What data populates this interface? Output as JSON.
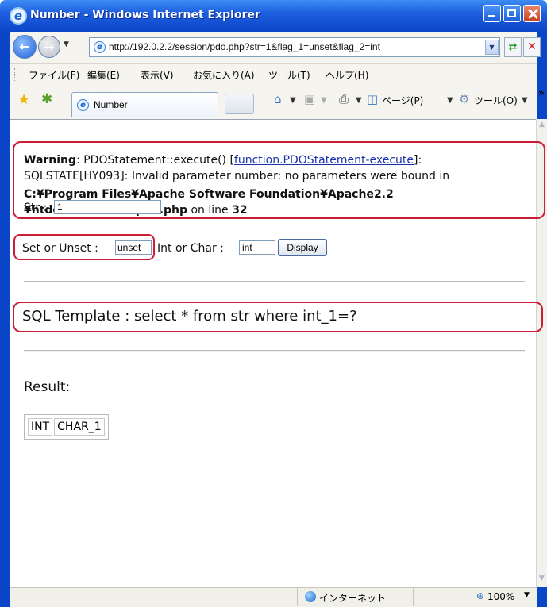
{
  "window": {
    "title": "Number - Windows Internet Explorer"
  },
  "address": {
    "url": "http://192.0.2.2/session/pdo.php?str=1&flag_1=unset&flag_2=int"
  },
  "menu": {
    "items": [
      "ファイル(F)",
      "編集(E)",
      "表示(V)",
      "お気に入り(A)",
      "ツール(T)",
      "ヘルプ(H)"
    ]
  },
  "tabs": {
    "active_label": "Number"
  },
  "command_bar": {
    "page": "ページ(P)",
    "tools": "ツール(O)"
  },
  "page": {
    "warning": {
      "label": "Warning",
      "line1_pre": ": PDOStatement::execute() [",
      "link": "function.PDOStatement-execute",
      "line1_post": "]:",
      "line2": "SQLSTATE[HY093]: Invalid parameter number: no parameters were bound in",
      "line3": "C:¥Program Files¥Apache Software Foundation¥Apache2.2",
      "line4_path": "¥htdocs¥session¥pdo.php",
      "line4_mid": " on line ",
      "line4_num": "32"
    },
    "form": {
      "str_label": "Str :",
      "str_value": "1",
      "setunset_label": "Set or Unset :",
      "setunset_value": "unset",
      "intchar_label": "Int or Char :",
      "intchar_value": "int",
      "display_button": "Display"
    },
    "sql_template": "SQL Template : select * from str where int_1=?",
    "result_label": "Result:",
    "result_columns": [
      "INT",
      "CHAR_1"
    ]
  },
  "status": {
    "zone": "インターネット",
    "zoom": "100%"
  },
  "colors": {
    "highlight": "#cc1d35",
    "titlebar": "#0b46c8",
    "link": "#1a33aa"
  },
  "icons": [
    "ie-logo-icon",
    "back-arrow-icon",
    "forward-arrow-icon",
    "refresh-icon",
    "stop-icon",
    "favorites-star-icon",
    "add-favorites-icon",
    "home-icon",
    "feeds-icon",
    "print-icon",
    "page-icon",
    "tools-gear-icon",
    "globe-icon",
    "zoom-icon"
  ]
}
